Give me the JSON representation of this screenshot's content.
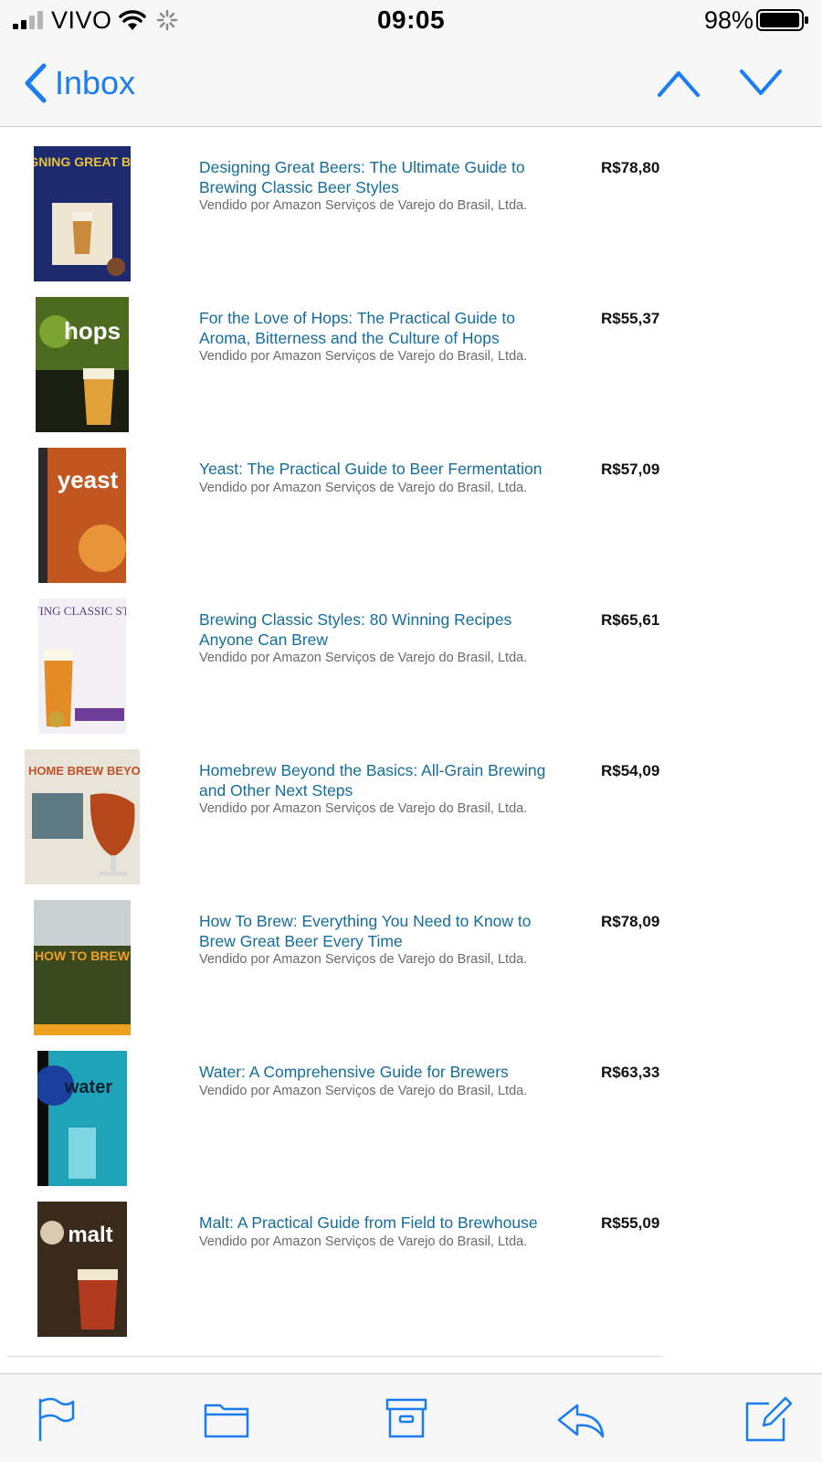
{
  "status_bar": {
    "carrier": "VIVO",
    "time": "09:05",
    "battery_percent": "98%",
    "battery_level": 0.98
  },
  "nav": {
    "back_label": "Inbox"
  },
  "colors": {
    "accent": "#1a7cf2",
    "link": "#136d9e",
    "seller_text": "#6b6b6b"
  },
  "items": [
    {
      "title": "Designing Great Beers: The Ultimate Guide to Brewing Classic Beer Styles",
      "seller": "Vendido por Amazon Serviços de Varejo do Brasil, Ltda.",
      "price": "R$78,80",
      "cover_text": "DESIGNING GREAT BEERS"
    },
    {
      "title": "For the Love of Hops: The Practical Guide to Aroma, Bitterness and the Culture of Hops",
      "seller": "Vendido por Amazon Serviços de Varejo do Brasil, Ltda.",
      "price": "R$55,37",
      "cover_text": "hops"
    },
    {
      "title": "Yeast: The Practical Guide to Beer Fermentation",
      "seller": "Vendido por Amazon Serviços de Varejo do Brasil, Ltda.",
      "price": "R$57,09",
      "cover_text": "yeast"
    },
    {
      "title": "Brewing Classic Styles: 80 Winning Recipes Anyone Can Brew",
      "seller": "Vendido por Amazon Serviços de Varejo do Brasil, Ltda.",
      "price": "R$65,61",
      "cover_text": "BREWING CLASSIC STYLES"
    },
    {
      "title": "Homebrew Beyond the Basics: All-Grain Brewing and Other Next Steps",
      "seller": "Vendido por Amazon Serviços de Varejo do Brasil, Ltda.",
      "price": "R$54,09",
      "cover_text": "HOME BREW BEYOND THE BASICS"
    },
    {
      "title": "How To Brew: Everything You Need to Know to Brew Great Beer Every Time",
      "seller": "Vendido por Amazon Serviços de Varejo do Brasil, Ltda.",
      "price": "R$78,09",
      "cover_text": "HOW TO BREW"
    },
    {
      "title": "Water: A Comprehensive Guide for Brewers",
      "seller": "Vendido por Amazon Serviços de Varejo do Brasil, Ltda.",
      "price": "R$63,33",
      "cover_text": "water"
    },
    {
      "title": "Malt: A Practical Guide from Field to Brewhouse",
      "seller": "Vendido por Amazon Serviços de Varejo do Brasil, Ltda.",
      "price": "R$55,09",
      "cover_text": "malt"
    }
  ],
  "toolbar": {
    "icons": [
      "flag-icon",
      "folder-icon",
      "archive-icon",
      "reply-icon",
      "compose-icon"
    ]
  }
}
